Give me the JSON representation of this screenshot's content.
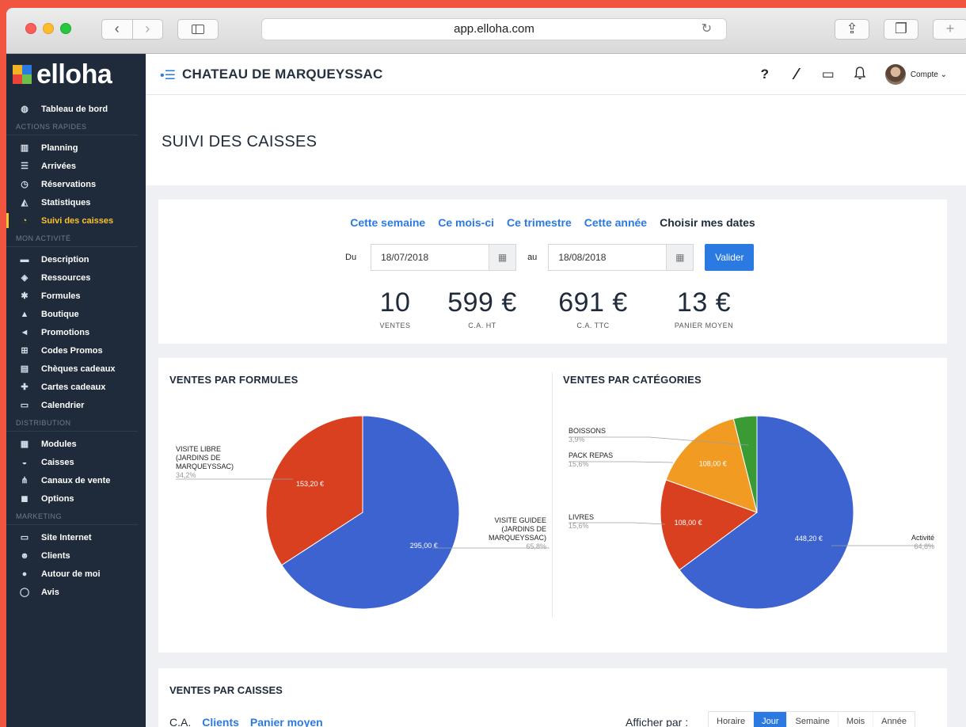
{
  "browser": {
    "url": "app.elloha.com",
    "back_glyph": "‹",
    "forward_glyph": "›",
    "share_glyph": "⇪",
    "tabs_glyph": "❐",
    "new_tab_glyph": "+",
    "reload_glyph": "↻"
  },
  "brand": {
    "name": "elloha",
    "colors": [
      "#f0b323",
      "#2a7ae2",
      "#e84538",
      "#6cc04a"
    ]
  },
  "sidebar": {
    "dashboard": {
      "label": "Tableau de bord",
      "icon": "dashboard-icon",
      "glyph": "◍"
    },
    "sections": [
      {
        "title": "ACTIONS RAPIDES",
        "items": [
          {
            "label": "Planning",
            "icon": "planning-icon",
            "glyph": "▥"
          },
          {
            "label": "Arrivées",
            "icon": "arrivals-icon",
            "glyph": "☰"
          },
          {
            "label": "Réservations",
            "icon": "clock-icon",
            "glyph": "◷"
          },
          {
            "label": "Statistiques",
            "icon": "statistics-icon",
            "glyph": "◭"
          },
          {
            "label": "Suivi des caisses",
            "icon": "cash-register-icon",
            "glyph": "◔",
            "active": true
          }
        ]
      },
      {
        "title": "MON ACTIVITÉ",
        "items": [
          {
            "label": "Description",
            "icon": "briefcase-icon",
            "glyph": "▬"
          },
          {
            "label": "Ressources",
            "icon": "cube-icon",
            "glyph": "◈"
          },
          {
            "label": "Formules",
            "icon": "formulas-icon",
            "glyph": "✱"
          },
          {
            "label": "Boutique",
            "icon": "shop-icon",
            "glyph": "▲"
          },
          {
            "label": "Promotions",
            "icon": "megaphone-icon",
            "glyph": "◄"
          },
          {
            "label": "Codes Promos",
            "icon": "cart-icon",
            "glyph": "⊞"
          },
          {
            "label": "Chèques cadeaux",
            "icon": "voucher-icon",
            "glyph": "▤"
          },
          {
            "label": "Cartes cadeaux",
            "icon": "gift-icon",
            "glyph": "✚"
          },
          {
            "label": "Calendrier",
            "icon": "calendar-icon",
            "glyph": "▭"
          }
        ]
      },
      {
        "title": "DISTRIBUTION",
        "items": [
          {
            "label": "Modules",
            "icon": "modules-icon",
            "glyph": "▦"
          },
          {
            "label": "Caisses",
            "icon": "register-icon",
            "glyph": "◒"
          },
          {
            "label": "Canaux de vente",
            "icon": "sitemap-icon",
            "glyph": "⋔"
          },
          {
            "label": "Options",
            "icon": "options-icon",
            "glyph": "◼"
          }
        ]
      },
      {
        "title": "MARKETING",
        "items": [
          {
            "label": "Site Internet",
            "icon": "laptop-icon",
            "glyph": "▭"
          },
          {
            "label": "Clients",
            "icon": "users-icon",
            "glyph": "☻"
          },
          {
            "label": "Autour de moi",
            "icon": "pin-icon",
            "glyph": "●"
          },
          {
            "label": "Avis",
            "icon": "comment-icon",
            "glyph": "◯"
          }
        ]
      }
    ]
  },
  "header": {
    "menu_glyph": "•☰",
    "hotel_name": "CHATEAU DE MARQUEYSSAC",
    "help_glyph": "?",
    "magic_glyph": "⁄",
    "monitor_glyph": "▭",
    "bell_glyph": "♫",
    "account_label": "Compte ⌄"
  },
  "page": {
    "title": "SUIVI DES CAISSES"
  },
  "filters": {
    "periods": [
      "Cette semaine",
      "Ce mois-ci",
      "Ce trimestre",
      "Cette année",
      "Choisir mes dates"
    ],
    "current_period": "Choisir mes dates",
    "from_label": "Du",
    "from_value": "18/07/2018",
    "to_label": "au",
    "to_value": "18/08/2018",
    "calendar_glyph": "▦",
    "submit_label": "Valider"
  },
  "kpis": [
    {
      "value": "10",
      "label": "VENTES"
    },
    {
      "value": "599 €",
      "label": "C.A. HT"
    },
    {
      "value": "691 €",
      "label": "C.A. TTC"
    },
    {
      "value": "13 €",
      "label": "PANIER MOYEN"
    }
  ],
  "chart_data": [
    {
      "type": "pie",
      "title": "VENTES PAR FORMULES",
      "slices": [
        {
          "name": "VISITE GUIDEE (JARDINS DE MARQUEYSSAC)",
          "value": 295.0,
          "value_label": "295,00 €",
          "percent_label": "65,8%",
          "color": "#3c63cf"
        },
        {
          "name": "VISITE LIBRE (JARDINS DE MARQUEYSSAC)",
          "value": 153.2,
          "value_label": "153,20 €",
          "percent_label": "34,2%",
          "color": "#d8401f"
        }
      ]
    },
    {
      "type": "pie",
      "title": "VENTES PAR CATÉGORIES",
      "slices": [
        {
          "name": "Activité",
          "value": 448.2,
          "value_label": "448,20 €",
          "percent_label": "64,8%",
          "color": "#3c63cf"
        },
        {
          "name": "LIVRES",
          "value": 108.0,
          "value_label": "108,00 €",
          "percent_label": "15,6%",
          "color": "#d8401f"
        },
        {
          "name": "PACK REPAS",
          "value": 108.0,
          "value_label": "108,00 €",
          "percent_label": "15,6%",
          "color": "#f29b22"
        },
        {
          "name": "BOISSONS",
          "value": 27.0,
          "value_label": "",
          "percent_label": "3,9%",
          "color": "#3a9b35"
        }
      ]
    }
  ],
  "caisses": {
    "title": "VENTES PAR CAISSES",
    "metrics": [
      "C.A.",
      "Clients",
      "Panier moyen"
    ],
    "current_metric": "C.A.",
    "show_by_label": "Afficher par :",
    "granularities": [
      "Horaire",
      "Jour",
      "Semaine",
      "Mois",
      "Année"
    ],
    "current_granularity": "Jour"
  }
}
